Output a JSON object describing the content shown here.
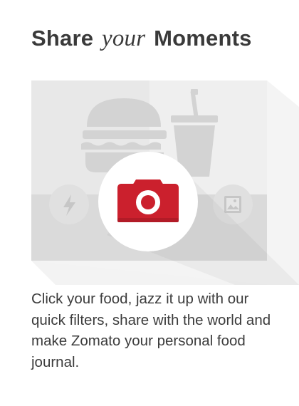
{
  "heading": {
    "part1": "Share",
    "part2": "your",
    "part3": "Moments"
  },
  "illustration": {
    "icons": [
      "burger-icon",
      "drink-cup-icon",
      "flash-icon",
      "camera-icon",
      "gallery-icon"
    ],
    "colors": {
      "panel": "#e9e9e9",
      "panel_light": "#f3f3f3",
      "ground": "#dcdcdc",
      "silhouette": "#d2d2d2",
      "shadow": "#f2f2f2",
      "camera_red": "#cb202d",
      "white": "#ffffff"
    }
  },
  "description": "Click your food, jazz it up with our quick filters, share with the world and make Zomato your personal food journal."
}
